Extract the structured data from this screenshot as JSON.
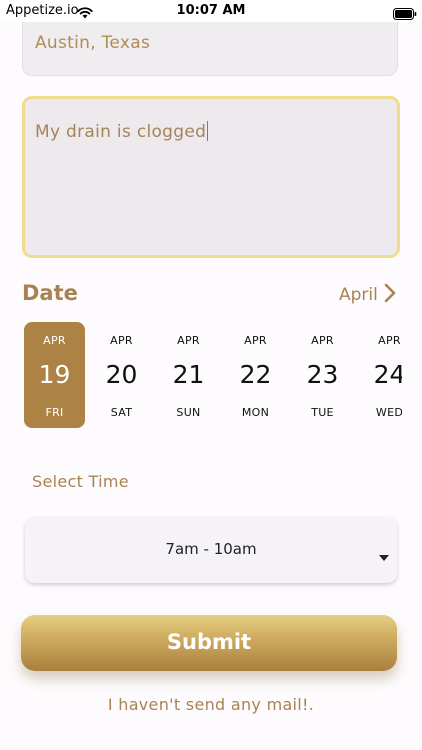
{
  "status_bar": {
    "carrier": "Appetize.io",
    "time": "10:07 AM"
  },
  "form": {
    "location_value": "Austin, Texas",
    "description_value": "My drain is clogged"
  },
  "date_section": {
    "heading": "Date",
    "month": "April",
    "days": [
      {
        "month": "APR",
        "day": "19",
        "weekday": "FRI",
        "selected": true
      },
      {
        "month": "APR",
        "day": "20",
        "weekday": "SAT",
        "selected": false
      },
      {
        "month": "APR",
        "day": "21",
        "weekday": "SUN",
        "selected": false
      },
      {
        "month": "APR",
        "day": "22",
        "weekday": "MON",
        "selected": false
      },
      {
        "month": "APR",
        "day": "23",
        "weekday": "TUE",
        "selected": false
      },
      {
        "month": "APR",
        "day": "24",
        "weekday": "WED",
        "selected": false
      }
    ]
  },
  "time_section": {
    "label": "Select Time",
    "selected_value": "7am - 10am"
  },
  "submit_label": "Submit",
  "footer_link": "I haven't send any mail!.",
  "colors": {
    "accent": "#a88352",
    "selected_day": "#ad8345",
    "focus_border": "#f0dc8c"
  },
  "icons": [
    "wifi-icon",
    "battery-icon",
    "chevron-right-icon",
    "dropdown-arrow-icon"
  ]
}
